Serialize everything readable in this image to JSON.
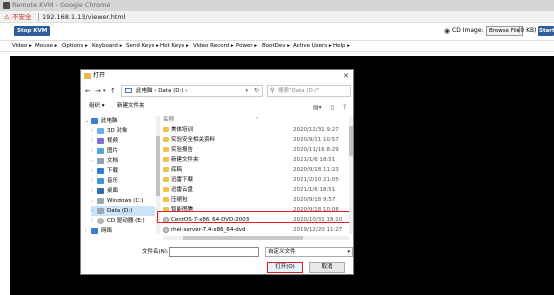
{
  "browser": {
    "title": "Remote KVM - Google Chrome",
    "warning_label": "不安全",
    "url": "192.168.1.13/viewer.html"
  },
  "kvm": {
    "stop_button": "Stop KVM",
    "cd_image_label": "CD Image:",
    "browse_button": "Browse File",
    "size_label": "(0 KB)",
    "start_button": "Start",
    "menus": [
      "Video ▸",
      "Mouse ▸",
      "Options ▸",
      "Keyboard ▸",
      "Send Keys ▸",
      "Hot Keys ▸",
      "Video Record ▸",
      "Power ▸",
      "BootDev ▸",
      "Active Users ▸",
      "Help ▸"
    ]
  },
  "dialog": {
    "title": "打开",
    "close": "✕",
    "path": "此电脑 › Data (D:) ›",
    "search_placeholder": "搜索\"Data (D:)\"",
    "organize": "组织 ▾",
    "new_folder": "新建文件夹",
    "tree": [
      {
        "label": "此电脑",
        "icon": "computer-icon",
        "selected": false
      },
      {
        "label": "3D 对象",
        "icon": "3d-objects-icon",
        "selected": false
      },
      {
        "label": "视频",
        "icon": "video-icon",
        "selected": false
      },
      {
        "label": "图片",
        "icon": "pictures-icon",
        "selected": false
      },
      {
        "label": "文档",
        "icon": "documents-icon",
        "selected": false
      },
      {
        "label": "下载",
        "icon": "download-icon",
        "selected": false
      },
      {
        "label": "音乐",
        "icon": "music-icon",
        "selected": false
      },
      {
        "label": "桌面",
        "icon": "desktop-icon",
        "selected": false
      },
      {
        "label": "Windows (C:)",
        "icon": "drive-icon",
        "selected": false
      },
      {
        "label": "Data (D:)",
        "icon": "drive-icon",
        "selected": true
      },
      {
        "label": "CD 驱动器 (E:)",
        "icon": "cd-drive-icon",
        "selected": false
      },
      {
        "label": "网络",
        "icon": "network-icon",
        "selected": false
      }
    ],
    "column_name": "名称",
    "files": [
      {
        "name": "美体培训",
        "date": "2020/12/31 9:27",
        "type": "folder"
      },
      {
        "name": "实验安全相关资料",
        "date": "2020/9/11 10:57",
        "type": "folder"
      },
      {
        "name": "实验报告",
        "date": "2020/11/16 8:29",
        "type": "folder"
      },
      {
        "name": "新建文件夹",
        "date": "2021/1/6 18:51",
        "type": "folder"
      },
      {
        "name": "底稿",
        "date": "2020/9/18 11:23",
        "type": "folder"
      },
      {
        "name": "迅雷下载",
        "date": "2021/2/10 21:05",
        "type": "folder"
      },
      {
        "name": "迅雷云盘",
        "date": "2021/1/6 18:51",
        "type": "folder"
      },
      {
        "name": "压缩包",
        "date": "2020/9/18 9:57",
        "type": "folder"
      },
      {
        "name": "智能图腾",
        "date": "2020/9/18 10:08",
        "type": "folder"
      },
      {
        "name": "CentOS-7-x86_64-DVD-2003",
        "date": "2020/10/31 18:10",
        "type": "disc"
      },
      {
        "name": "rhel-server-7.4-x86_64-dvd",
        "date": "2019/12/20 11:27",
        "type": "disc"
      }
    ],
    "filename_label": "文件名(N):",
    "filename_value": "",
    "filter_value": "自定义文件",
    "open_button": "打开(O)",
    "cancel_button": "取消"
  }
}
